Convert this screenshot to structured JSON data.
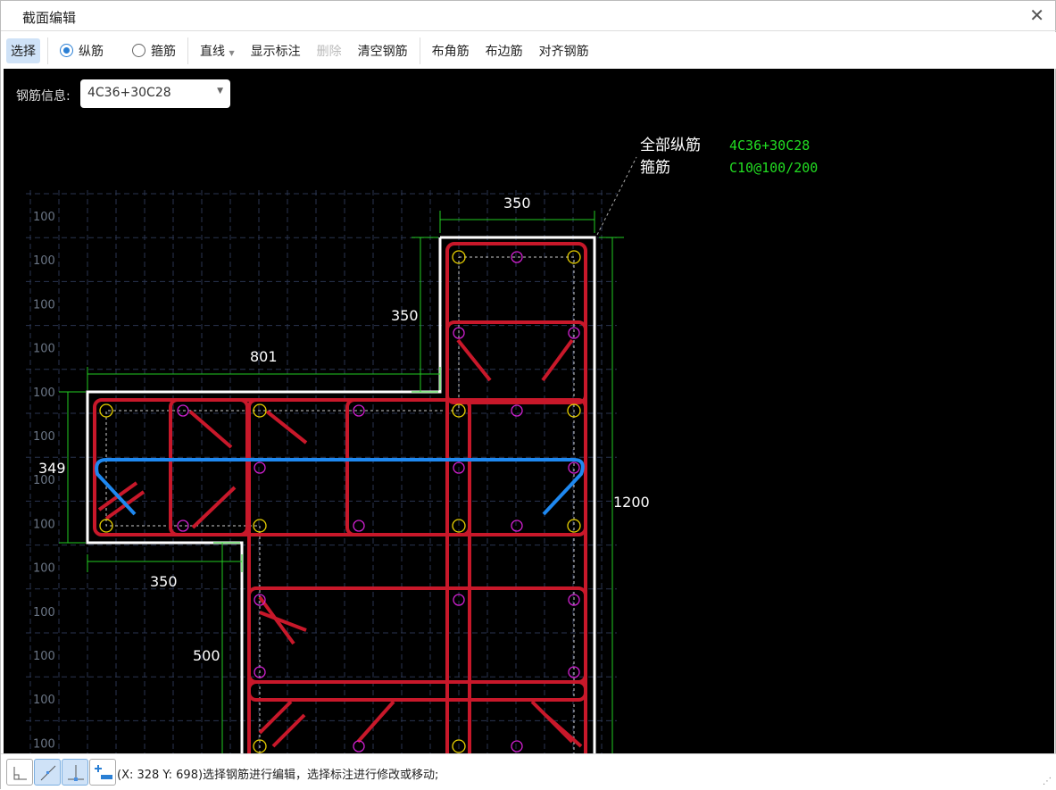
{
  "window": {
    "title": "截面编辑",
    "close_icon": "close-icon"
  },
  "toolbar": {
    "select": "选择",
    "longitudinal": "纵筋",
    "stirrup": "箍筋",
    "line_type": "直线",
    "show_dims": "显示标注",
    "delete": "删除",
    "clear": "清空钢筋",
    "corner": "布角筋",
    "edge": "布边筋",
    "align": "对齐钢筋"
  },
  "rebar_info": {
    "label": "钢筋信息:",
    "value": "4C36+30C28"
  },
  "legend": {
    "all_long_label": "全部纵筋",
    "all_long_value": "4C36+30C28",
    "stirrup_label": "箍筋",
    "stirrup_value": "C10@100/200"
  },
  "dims": {
    "top_width": "350",
    "top_height": "350",
    "left_width": "801",
    "left_height": "349",
    "bottom_width": "350",
    "bottom_height": "500",
    "total_height": "1200"
  },
  "grid_labels": [
    "100",
    "100",
    "100",
    "100",
    "100",
    "100",
    "100",
    "100",
    "100",
    "100",
    "100",
    "100",
    "100"
  ],
  "status": {
    "text": "(X: 328 Y: 698)选择钢筋进行编辑，选择标注进行修改或移动;"
  },
  "colors": {
    "stirrup": "#c8182a",
    "tie": "#1e88f0",
    "corner_bar": "#e8d000",
    "edge_bar": "#d020d0",
    "dim": "#22cc22",
    "legend_value": "#22dd22"
  }
}
